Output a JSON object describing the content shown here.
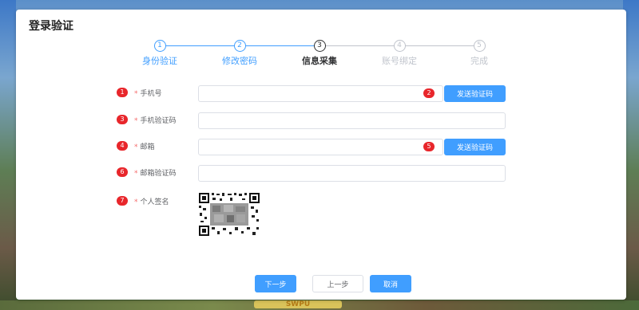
{
  "dialog": {
    "title": "登录验证"
  },
  "steps": [
    {
      "num": "1",
      "label": "身份验证",
      "state": "done"
    },
    {
      "num": "2",
      "label": "修改密码",
      "state": "done"
    },
    {
      "num": "3",
      "label": "信息采集",
      "state": "current"
    },
    {
      "num": "4",
      "label": "账号绑定",
      "state": "todo"
    },
    {
      "num": "5",
      "label": "完成",
      "state": "todo"
    }
  ],
  "form": {
    "phone": {
      "badge": "1",
      "required": "*",
      "label": "手机号",
      "value": "",
      "send_badge": "2",
      "send_label": "发送验证码"
    },
    "phone_code": {
      "badge": "3",
      "required": "*",
      "label": "手机验证码",
      "value": ""
    },
    "email": {
      "badge": "4",
      "required": "*",
      "label": "邮箱",
      "value": "",
      "send_badge": "5",
      "send_label": "发送验证码"
    },
    "email_code": {
      "badge": "6",
      "required": "*",
      "label": "邮箱验证码",
      "value": ""
    },
    "signature": {
      "badge": "7",
      "required": "*",
      "label": "个人签名"
    }
  },
  "footer": {
    "next_label": "下一步",
    "prev_label": "上一步",
    "cancel_label": "取消"
  },
  "background": {
    "banner_text": "SWPU"
  },
  "colors": {
    "accent": "#409eff",
    "badge": "#e8262b",
    "required": "#f56c6c",
    "step_todo": "#c0c4cc"
  }
}
